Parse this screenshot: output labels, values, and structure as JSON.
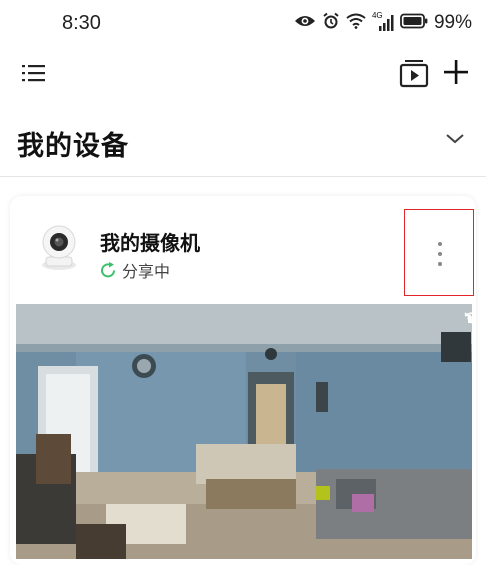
{
  "status_bar": {
    "time": "8:30",
    "network_label": "4G",
    "battery": "99%"
  },
  "toolbar": {
    "menu_icon": "list-icon",
    "video_icon": "video-playlist-icon",
    "add_icon": "plus-icon"
  },
  "page": {
    "title": "我的设备",
    "collapse_icon": "chevron-down-icon"
  },
  "device": {
    "name": "我的摄像机",
    "status": "分享中",
    "status_color": "#3cbf6a",
    "more_icon": "more-vertical-icon",
    "highlight_color": "#e0262b"
  },
  "preview": {
    "wifi_icon": "wifi-icon",
    "mute_icon": "mute-icon"
  }
}
